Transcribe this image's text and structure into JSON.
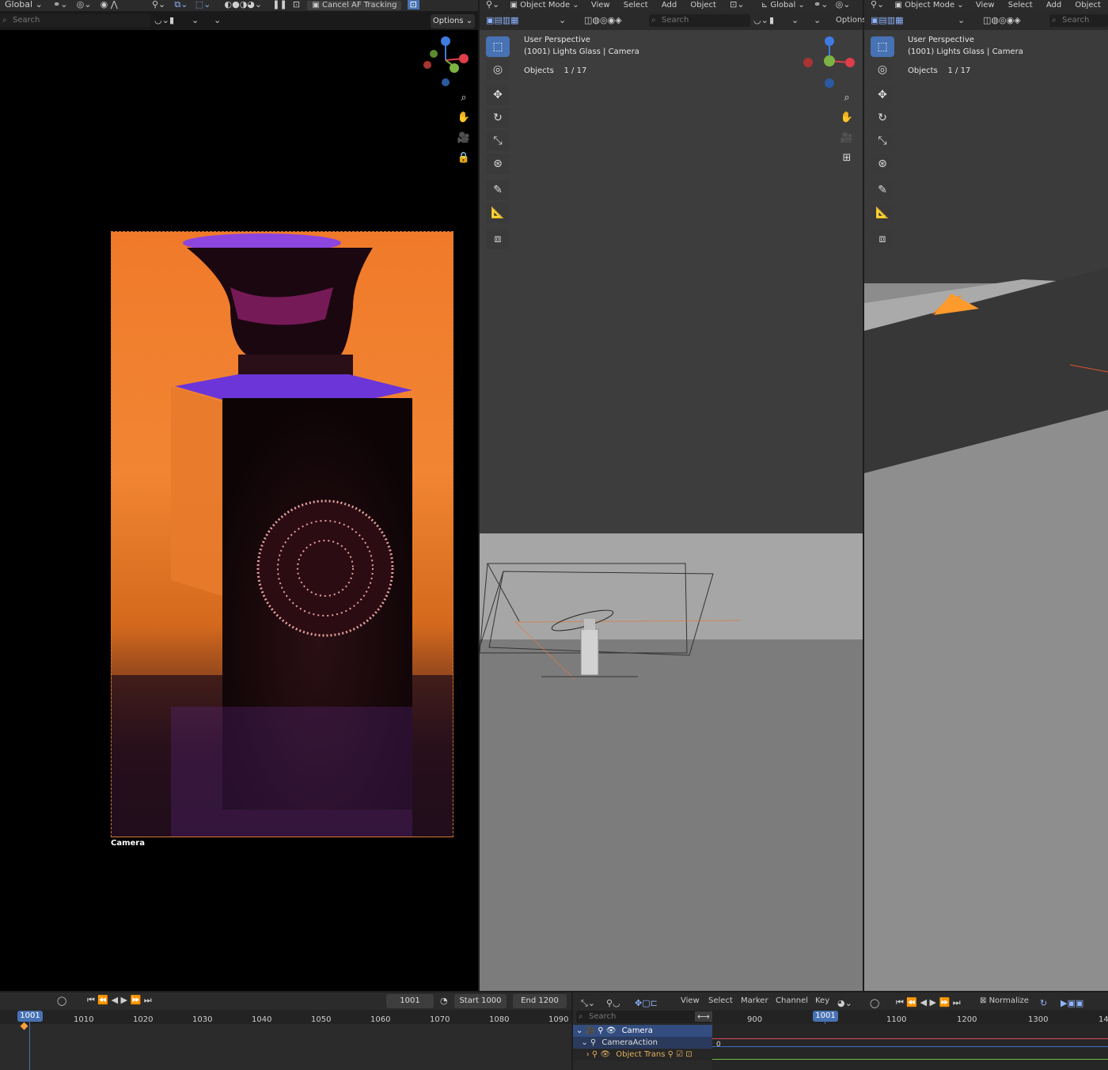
{
  "left_header": {
    "orientation": "Global",
    "cancel_af": "Cancel AF Tracking",
    "search_placeholder": "Search",
    "options": "Options"
  },
  "left_viewport": {
    "camera_label": "Camera"
  },
  "mid_header": {
    "mode": "Object Mode",
    "menus": [
      "View",
      "Select",
      "Add",
      "Object"
    ],
    "orientation": "Global",
    "search_placeholder": "Search",
    "options": "Options"
  },
  "mid_viewport": {
    "perspective": "User Perspective",
    "scene": "(1001) Lights Glass | Camera",
    "objects_label": "Objects",
    "objects_value": "1 / 17"
  },
  "right_header": {
    "mode": "Object Mode",
    "menus": [
      "View",
      "Select",
      "Add",
      "Object"
    ],
    "search_placeholder": "Search"
  },
  "right_viewport": {
    "perspective": "User Perspective",
    "scene": "(1001) Lights Glass | Camera",
    "objects_label": "Objects",
    "objects_value": "1 / 17"
  },
  "timeline": {
    "current_frame": "1001",
    "start_label": "Start",
    "start_value": "1000",
    "end_label": "End",
    "end_value": "1200",
    "ticks": [
      "1001",
      "1010",
      "1020",
      "1030",
      "1040",
      "1050",
      "1060",
      "1070",
      "1080",
      "1090"
    ]
  },
  "graph_editor": {
    "menus": [
      "View",
      "Select",
      "Marker",
      "Channel",
      "Key"
    ],
    "normalize": "Normalize",
    "search_placeholder": "Search",
    "ticks": [
      "900",
      "1001",
      "1100",
      "1200",
      "1300",
      "14"
    ],
    "channels": [
      "Camera",
      "CameraAction",
      "Object Trans"
    ],
    "key_value": "0"
  },
  "colors": {
    "accent": "#4772b3",
    "orange": "#ff7a1f",
    "purple": "#7a3cff"
  }
}
